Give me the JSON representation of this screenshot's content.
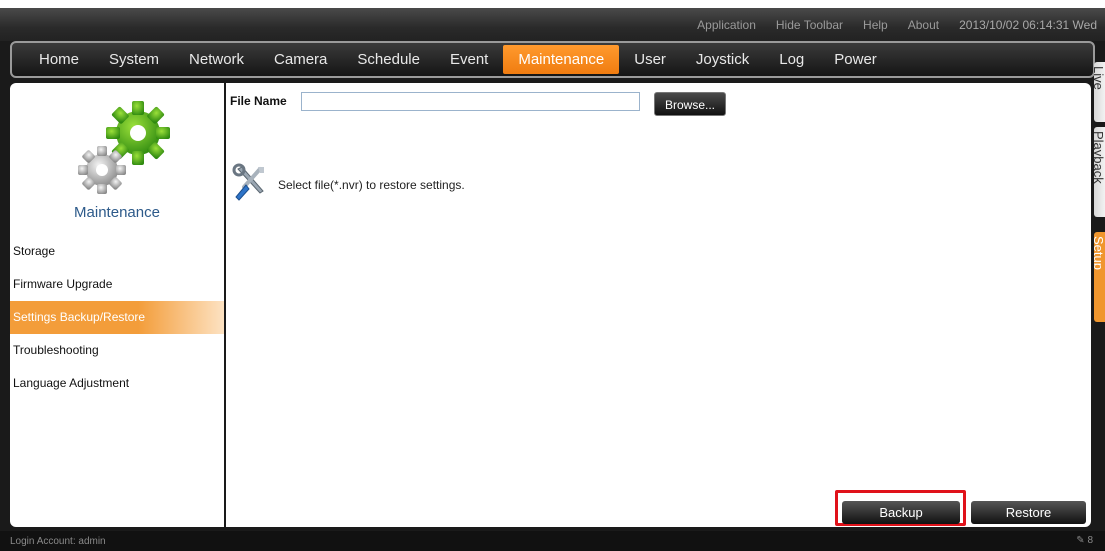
{
  "toolbar": {
    "items": [
      "Application",
      "Hide Toolbar",
      "Help",
      "About"
    ],
    "datetime": "2013/10/02 06:14:31 Wed"
  },
  "nav": {
    "items": [
      "Home",
      "System",
      "Network",
      "Camera",
      "Schedule",
      "Event",
      "Maintenance",
      "User",
      "Joystick",
      "Log",
      "Power"
    ],
    "active": "Maintenance",
    "accent_color": "#f28a1e"
  },
  "side_tabs": [
    "Live",
    "Playback",
    "Setup"
  ],
  "left_panel": {
    "title": "Maintenance",
    "menu": [
      "Storage",
      "Firmware Upgrade",
      "Settings Backup/Restore",
      "Troubleshooting",
      "Language Adjustment"
    ],
    "active": "Settings Backup/Restore"
  },
  "main": {
    "file_label": "File Name",
    "file_value": "",
    "browse_label": "Browse...",
    "hint": "Select file(*.nvr) to restore settings.",
    "backup_label": "Backup",
    "restore_label": "Restore",
    "highlight_color": "#e0121a"
  },
  "status": {
    "login": "Login Account: admin",
    "right_value": "8"
  }
}
